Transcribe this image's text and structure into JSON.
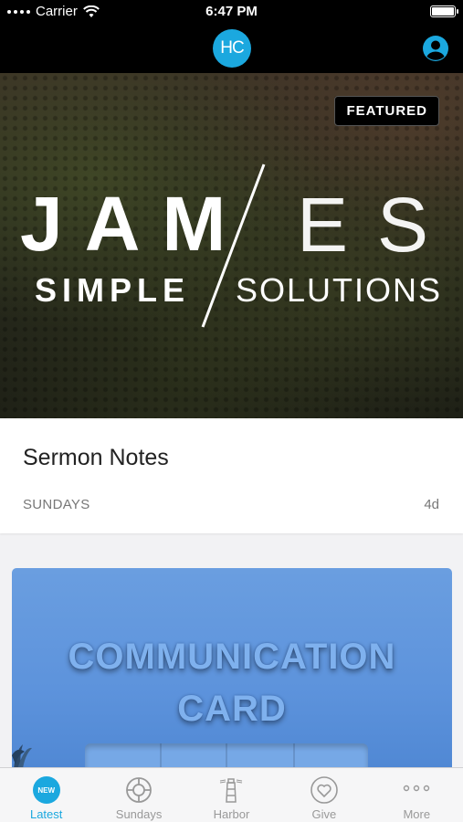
{
  "status_bar": {
    "carrier": "Carrier",
    "time": "6:47 PM"
  },
  "nav": {
    "logo_text": "HC"
  },
  "hero": {
    "badge": "FEATURED",
    "title_bold": "JAM",
    "title_thin": "ES",
    "subtitle_bold": "SIMPLE",
    "subtitle_thin": "SOLUTIONS"
  },
  "sermon": {
    "title": "Sermon Notes",
    "category": "SUNDAYS",
    "age": "4d"
  },
  "comm_card": {
    "line1": "COMMUNICATION",
    "line2": "CARD"
  },
  "tabs": [
    {
      "label": "Latest",
      "icon": "new-badge-icon",
      "badge": "NEW",
      "active": true
    },
    {
      "label": "Sundays",
      "icon": "lifebuoy-icon",
      "active": false
    },
    {
      "label": "Harbor",
      "icon": "lighthouse-icon",
      "active": false
    },
    {
      "label": "Give",
      "icon": "heart-icon",
      "active": false
    },
    {
      "label": "More",
      "icon": "more-dots-icon",
      "active": false
    }
  ],
  "colors": {
    "accent": "#1ba8df",
    "tab_inactive": "#999999",
    "bar_bg": "#000000"
  }
}
